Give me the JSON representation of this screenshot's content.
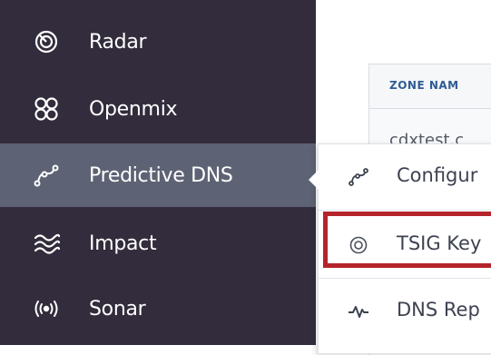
{
  "sidebar": {
    "items": [
      {
        "label": "Radar",
        "icon": "radar-icon"
      },
      {
        "label": "Openmix",
        "icon": "openmix-icon"
      },
      {
        "label": "Predictive DNS",
        "icon": "predictive-dns-icon",
        "active": true
      },
      {
        "label": "Impact",
        "icon": "impact-icon"
      },
      {
        "label": "Sonar",
        "icon": "sonar-icon"
      }
    ]
  },
  "table": {
    "header": "ZONE NAM",
    "rows": [
      "cdxtest.c"
    ]
  },
  "flyout": {
    "items": [
      {
        "label": "Configur",
        "icon": "configure-icon"
      },
      {
        "label": "TSIG Key",
        "icon": "tsig-key-icon",
        "highlighted": true
      },
      {
        "label": "DNS Rep",
        "icon": "dns-report-icon"
      }
    ]
  },
  "colors": {
    "sidebar_bg": "#322c3c",
    "sidebar_active": "#5d6274",
    "highlight": "#b5242b",
    "table_header_text": "#2f5c93"
  }
}
